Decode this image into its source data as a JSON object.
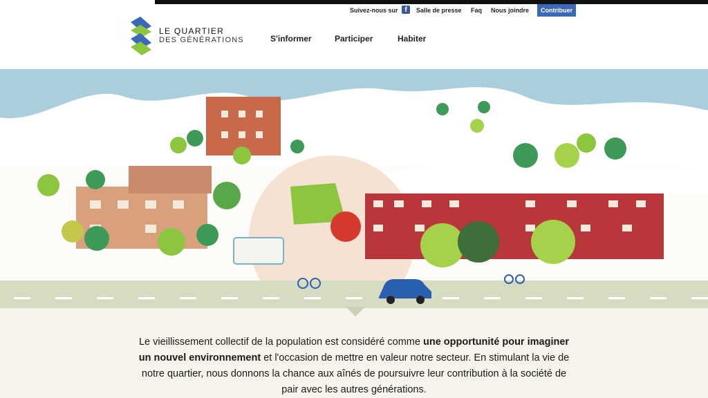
{
  "topbar": {
    "follow_label": "Suivez-nous sur",
    "facebook_icon": "facebook-icon",
    "links": [
      "Salle de presse",
      "Faq",
      "Nous joindre"
    ],
    "cta_label": "Contribuer",
    "cta_color": "#3b68b8"
  },
  "brand": {
    "line1": "LE QUARTIER",
    "line2": "DES GÉNÉRATIONS",
    "logo_colors": [
      "#3b68b8",
      "#8cc63f"
    ]
  },
  "nav": {
    "items": [
      "S'informer",
      "Participer",
      "Habiter"
    ]
  },
  "hero": {
    "alt": "Illustrated neighbourhood: river, trees, buildings, park, cyclists, blue car",
    "colors": {
      "water": "#a9cfdc",
      "road": "#d6dcc2",
      "accent_red": "#c0392b",
      "tree_green": "#8cc63f"
    }
  },
  "intro": {
    "p1": "Le vieillissement collectif de la population est considéré comme ",
    "b1": "une opportunité pour imaginer un nouvel environnement",
    "p2": " et l'occasion de mettre en valeur notre secteur. En stimulant la vie de notre quartier, nous donnons la chance aux aînés de poursuivre leur contribution à la société de pair avec les autres générations."
  }
}
